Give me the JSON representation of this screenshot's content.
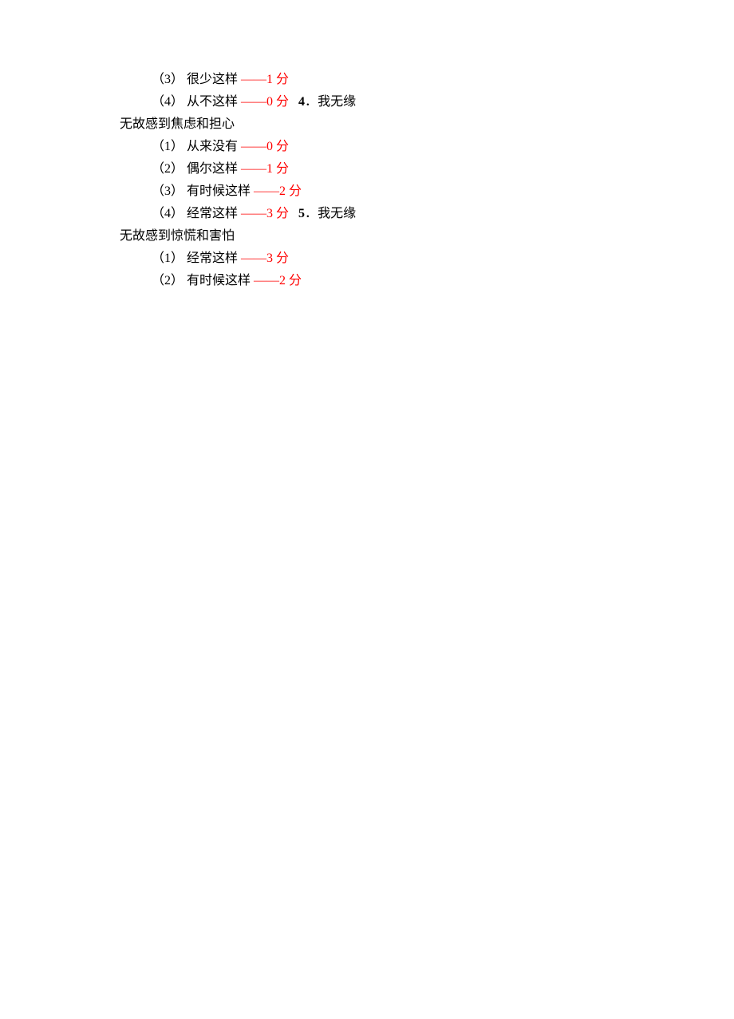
{
  "lines": [
    {
      "type": "option",
      "num": "（3）",
      "text": "很少这样",
      "score": "——1 分",
      "extra": null
    },
    {
      "type": "option",
      "num": "（4）",
      "text": "从不这样",
      "score": "——0 分",
      "extra": {
        "qnum": "4",
        "qtext": "我无缘"
      }
    },
    {
      "type": "wrap",
      "text": "无故感到焦虑和担心"
    },
    {
      "type": "option",
      "num": "（1）",
      "text": "从来没有",
      "score": "——0 分",
      "extra": null
    },
    {
      "type": "option",
      "num": "（2）",
      "text": "偶尔这样",
      "score": "——1 分",
      "extra": null
    },
    {
      "type": "option",
      "num": "（3）",
      "text": "有时候这样",
      "score": "——2 分",
      "extra": null
    },
    {
      "type": "option",
      "num": "（4）",
      "text": "经常这样",
      "score": "——3 分",
      "extra": {
        "qnum": "5",
        "qtext": "我无缘"
      }
    },
    {
      "type": "wrap",
      "text": "无故感到惊慌和害怕"
    },
    {
      "type": "option",
      "num": "（1）",
      "text": "经常这样",
      "score": "——3 分",
      "extra": null
    },
    {
      "type": "option",
      "num": "（2）",
      "text": "有时候这样",
      "score": "——2 分",
      "extra": null
    }
  ]
}
